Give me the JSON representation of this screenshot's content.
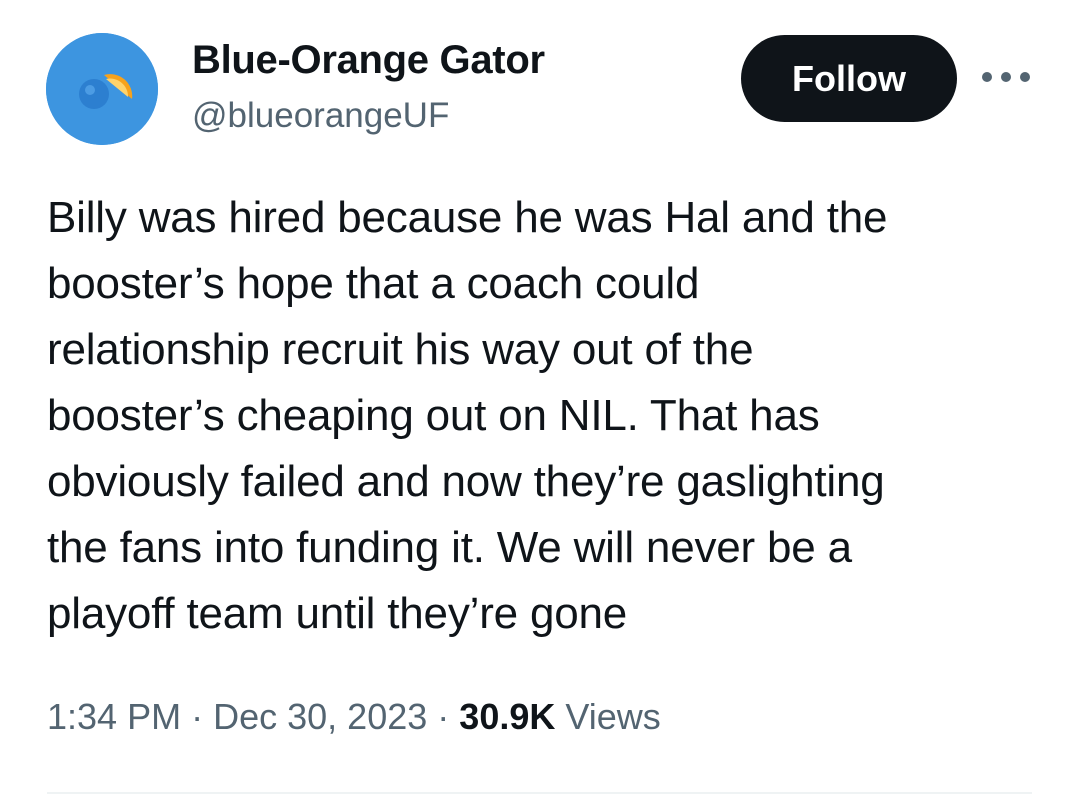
{
  "author": {
    "display_name": "Blue-Orange Gator",
    "handle": "@blueorangeUF",
    "avatar_icon": "blue-orange-gator-avatar"
  },
  "actions": {
    "follow_label": "Follow",
    "more_icon": "more-horizontal-icon"
  },
  "tweet": {
    "text": "Billy was hired because he was Hal and the\nbooster’s hope that a coach could\nrelationship recruit his way out of the\nbooster’s cheaping out on NIL. That has\nobviously failed and now they’re gaslighting\nthe fans into funding it. We will never be a\nplayoff team until they’re gone"
  },
  "meta": {
    "time": "1:34 PM",
    "separator": "·",
    "date": "Dec 30, 2023",
    "views_count": "30.9K",
    "views_label": "Views"
  },
  "colors": {
    "text_primary": "#0f1419",
    "text_secondary": "#536471",
    "follow_bg": "#0f1419",
    "avatar_bg": "#3d95e0",
    "avatar_orange": "#f7a21b"
  }
}
